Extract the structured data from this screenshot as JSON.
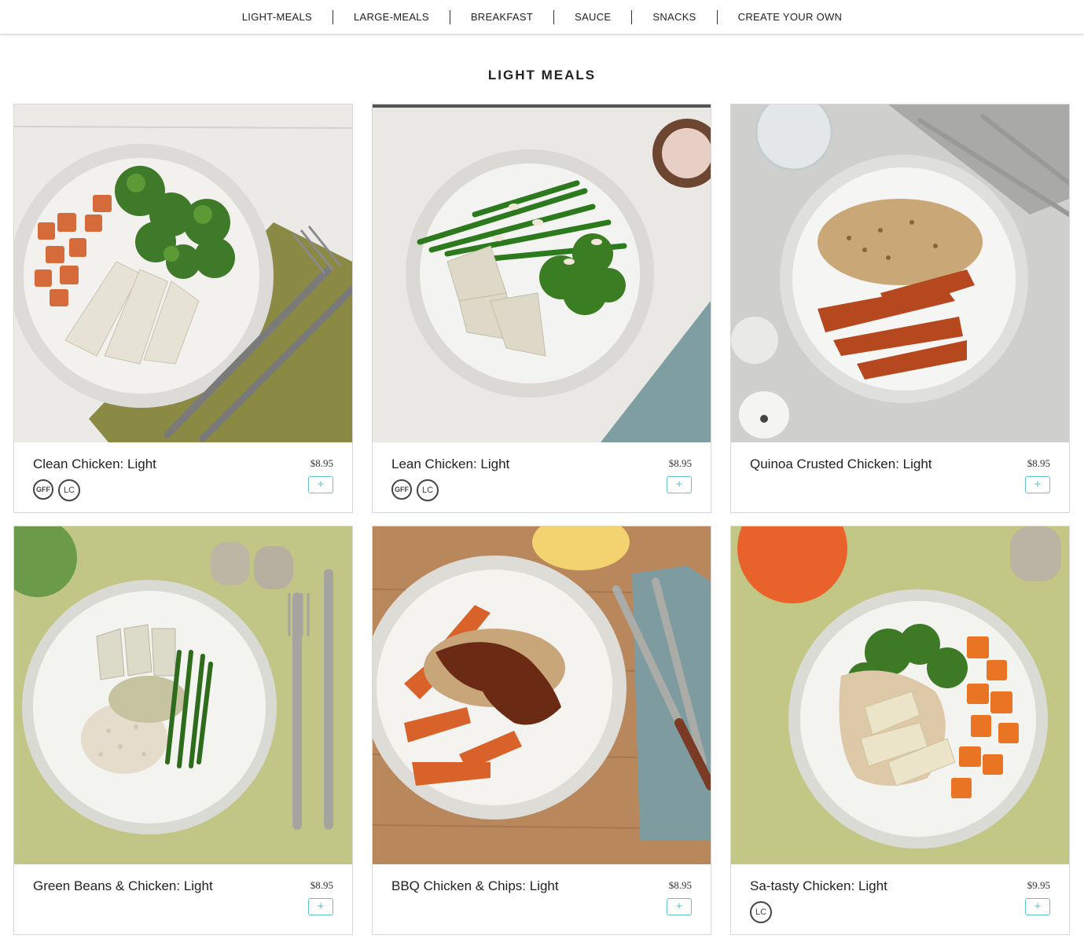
{
  "nav": {
    "items": [
      {
        "label": "LIGHT-MEALS"
      },
      {
        "label": "LARGE-MEALS"
      },
      {
        "label": "BREAKFAST"
      },
      {
        "label": "SAUCE"
      },
      {
        "label": "SNACKS"
      },
      {
        "label": "CREATE YOUR OWN"
      }
    ]
  },
  "section": {
    "title": "LIGHT MEALS"
  },
  "add_label": "+",
  "meals": [
    {
      "name": "Clean Chicken: Light",
      "price": "$8.95",
      "badges": [
        "GFF",
        "LC"
      ],
      "photo_icon": "plate-chicken-carrot-broccoli"
    },
    {
      "name": "Lean Chicken: Light",
      "price": "$8.95",
      "badges": [
        "GFF",
        "LC"
      ],
      "photo_icon": "plate-chicken-beans-broccoli"
    },
    {
      "name": "Quinoa Crusted Chicken: Light",
      "price": "$8.95",
      "badges": [],
      "photo_icon": "plate-quinoa-chicken-wedges"
    },
    {
      "name": "Green Beans & Chicken: Light",
      "price": "$8.95",
      "badges": [],
      "photo_icon": "plate-chicken-rice-beans"
    },
    {
      "name": "BBQ Chicken & Chips: Light",
      "price": "$8.95",
      "badges": [],
      "photo_icon": "plate-bbq-chicken-chips"
    },
    {
      "name": "Sa-tasty Chicken: Light",
      "price": "$9.95",
      "badges": [
        "LC"
      ],
      "photo_icon": "plate-satay-chicken-pumpkin"
    }
  ]
}
